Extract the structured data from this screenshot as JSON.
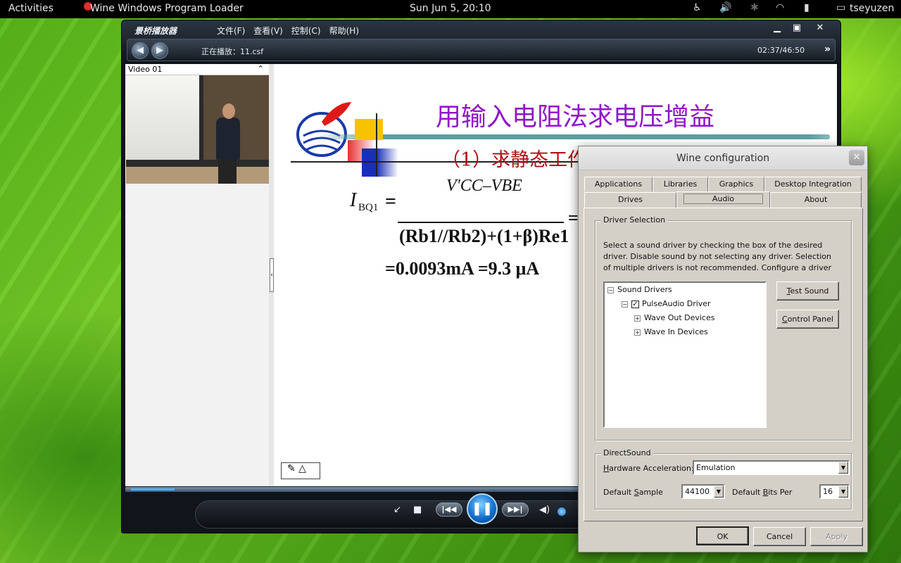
{
  "topbar": {
    "activities": "Activities",
    "app_title": "Wine Windows Program Loader",
    "clock": "Sun Jun  5, 20:10",
    "user": "tseyuzen"
  },
  "player": {
    "title": "景桥播放器",
    "menus": [
      "文件(F)",
      "查看(V)",
      "控制(C)",
      "帮助(H)"
    ],
    "now_playing": "正在播放：11.csf",
    "time": "02:37/46:50",
    "video_label": "Video 01",
    "slide": {
      "title": "用输入电阻法求电压增益",
      "subtitle": "（1）求静态工作",
      "formula_lhs": "I",
      "formula_lhs_sub": "BQ1",
      "formula_num": "V'CC–VBE",
      "formula_den": "(Rb1//Rb2)+(1+β)Re1",
      "formula_result": "=0.0093mA =9.3  μA"
    }
  },
  "wine": {
    "title": "Wine configuration",
    "tabs_row1": [
      "Applications",
      "Libraries",
      "Graphics",
      "Desktop Integration"
    ],
    "tabs_row2": [
      "Drives",
      "Audio",
      "About"
    ],
    "active_tab": "Audio",
    "driver_group": "Driver Selection",
    "driver_desc": "Select a sound driver by checking the box of the desired driver. Disable sound by not selecting any driver. Selection of multiple drivers is not recommended. Configure a driver by right-clicking on it.",
    "tree": {
      "root": "Sound Drivers",
      "driver": "PulseAudio Driver",
      "driver_checked": true,
      "children": [
        "Wave Out Devices",
        "Wave In Devices"
      ]
    },
    "test_sound": "Test Sound",
    "control_panel": "Control Panel",
    "directsound_group": "DirectSound",
    "hw_accel_label": "Hardware Acceleration:",
    "hw_accel_value": "Emulation",
    "sample_label": "Default Sample",
    "sample_value": "44100",
    "bits_label": "Default Bits Per",
    "bits_value": "16",
    "ok": "OK",
    "cancel": "Cancel",
    "apply": "Apply"
  }
}
